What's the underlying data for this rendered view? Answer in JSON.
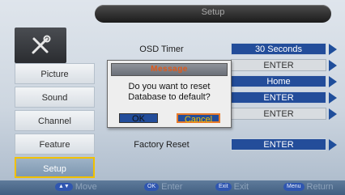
{
  "header": {
    "title": "Setup"
  },
  "sidebar": {
    "logo_icon": "tools-icon",
    "items": [
      {
        "label": "Picture"
      },
      {
        "label": "Sound"
      },
      {
        "label": "Channel"
      },
      {
        "label": "Feature"
      },
      {
        "label": "Setup",
        "active": true
      }
    ]
  },
  "menu": {
    "rows": [
      {
        "label": "OSD Timer",
        "value": "30 Seconds",
        "style": "blue"
      },
      {
        "label": "",
        "value": "ENTER",
        "style": "gray"
      },
      {
        "label": "",
        "value": "Home",
        "style": "blue"
      },
      {
        "label": "",
        "value": "ENTER",
        "style": "blue"
      },
      {
        "label": "",
        "value": "ENTER",
        "style": "gray"
      },
      {
        "label": "Factory Reset",
        "value": "ENTER",
        "style": "blue"
      }
    ]
  },
  "dialog": {
    "title": "Message",
    "line1": "Do you want to reset",
    "line2": "Database to  default?",
    "ok_label": "OK",
    "cancel_label": "Cancel"
  },
  "footer": {
    "move_key": "▲▼",
    "move_label": "Move",
    "enter_key": "OK",
    "enter_label": "Enter",
    "exit_key": "Exit",
    "exit_label": "Exit",
    "return_key": "Menu",
    "return_label": "Return"
  },
  "colors": {
    "accent_blue": "#234d9a",
    "highlight_yellow": "#f0c000",
    "cancel_border": "#e87a2a",
    "dialog_title_text": "#e05a1a"
  }
}
